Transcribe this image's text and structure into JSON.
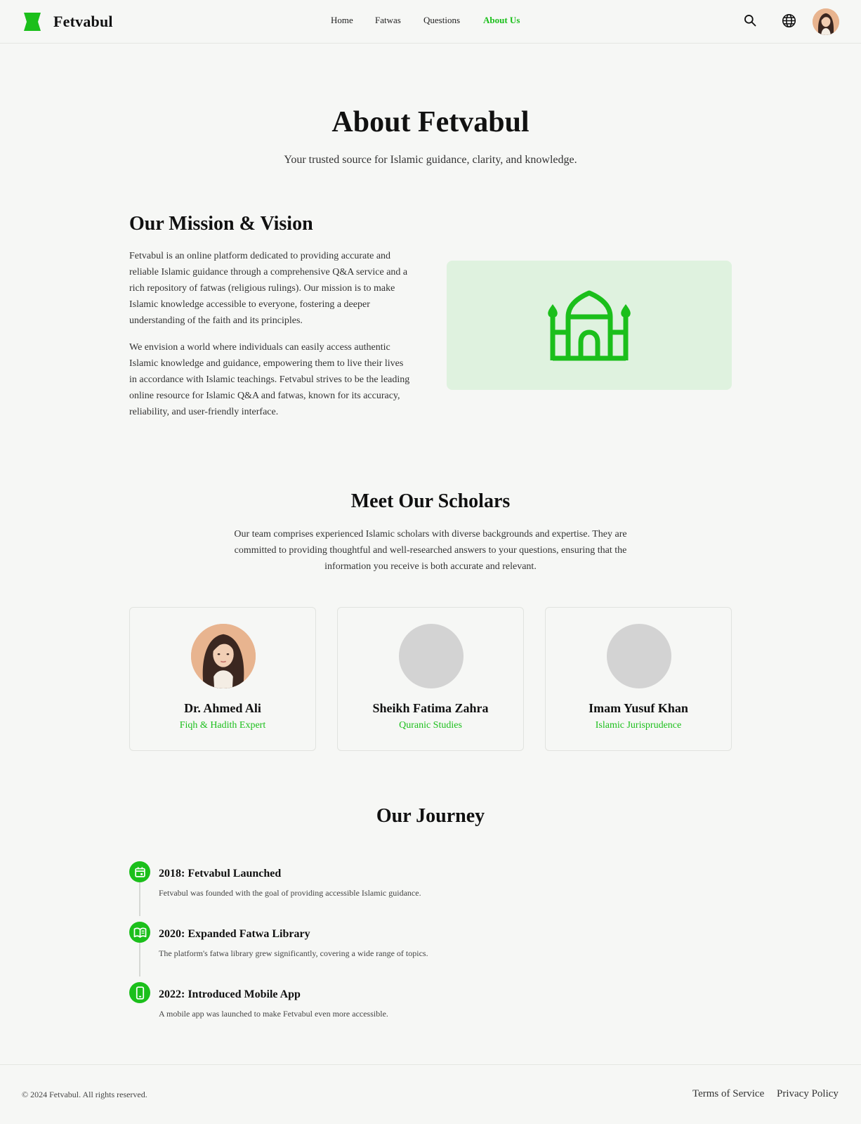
{
  "brand": {
    "name": "Fetvabul",
    "accent": "#1bbf1b"
  },
  "nav": {
    "items": [
      {
        "label": "Home"
      },
      {
        "label": "Fatwas"
      },
      {
        "label": "Questions"
      },
      {
        "label": "About Us",
        "active": true
      }
    ]
  },
  "header_icons": {
    "search": "search-icon",
    "language": "globe-icon",
    "profile": "user-avatar"
  },
  "hero": {
    "title": "About Fetvabul",
    "subtitle": "Your trusted source for Islamic guidance, clarity, and knowledge."
  },
  "mission": {
    "title": "Our Mission & Vision",
    "paragraphs": [
      "Fetvabul is an online platform dedicated to providing accurate and reliable Islamic guidance through a comprehensive Q&A service and a rich repository of fatwas (religious rulings). Our mission is to make Islamic knowledge accessible to everyone, fostering a deeper understanding of the faith and its principles.",
      "We envision a world where individuals can easily access authentic Islamic knowledge and guidance, empowering them to live their lives in accordance with Islamic teachings. Fetvabul strives to be the leading online resource for Islamic Q&A and fatwas, known for its accuracy, reliability, and user-friendly interface."
    ],
    "image_icon": "mosque-icon"
  },
  "scholars": {
    "title": "Meet Our Scholars",
    "description": "Our team comprises experienced Islamic scholars with diverse backgrounds and expertise. They are committed to providing thoughtful and well-researched answers to your questions, ensuring that the information you receive is both accurate and relevant.",
    "items": [
      {
        "name": "Dr. Ahmed Ali",
        "role": "Fiqh & Hadith Expert"
      },
      {
        "name": "Sheikh Fatima Zahra",
        "role": "Quranic Studies"
      },
      {
        "name": "Imam Yusuf Khan",
        "role": "Islamic Jurisprudence"
      }
    ]
  },
  "journey": {
    "title": "Our Journey",
    "items": [
      {
        "icon": "calendar-icon",
        "heading": "2018: Fetvabul Launched",
        "text": "Fetvabul was founded with the goal of providing accessible Islamic guidance."
      },
      {
        "icon": "book-icon",
        "heading": "2020: Expanded Fatwa Library",
        "text": "The platform's fatwa library grew significantly, covering a wide range of topics."
      },
      {
        "icon": "phone-icon",
        "heading": "2022: Introduced Mobile App",
        "text": "A mobile app was launched to make Fetvabul even more accessible."
      }
    ]
  },
  "footer": {
    "copyright": "© 2024 Fetvabul. All rights reserved.",
    "links": [
      {
        "label": "Terms of Service"
      },
      {
        "label": "Privacy Policy"
      }
    ]
  }
}
